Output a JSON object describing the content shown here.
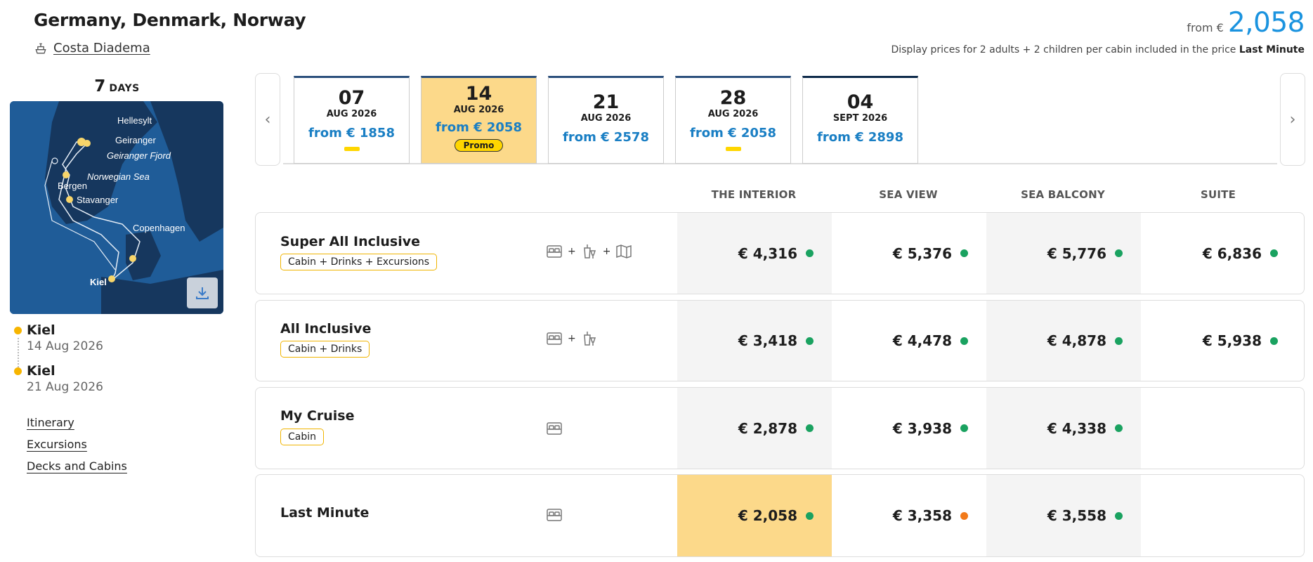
{
  "header": {
    "title": "Germany, Denmark, Norway",
    "ship_name": "Costa Diadema",
    "from_label": "from €",
    "from_value": "2,058",
    "price_note_prefix": "Display prices for 2 adults + 2 children per cabin included in the price",
    "price_note_bold": "Last Minute"
  },
  "sidebar": {
    "days_number": "7",
    "days_label": "DAYS",
    "map_labels": [
      "Hellesylt",
      "Geiranger",
      "Geiranger Fjord",
      "Norwegian Sea",
      "Bergen",
      "Stavanger",
      "Copenhagen",
      "Kiel"
    ],
    "stops": [
      {
        "name": "Kiel",
        "date": "14 Aug 2026"
      },
      {
        "name": "Kiel",
        "date": "21 Aug 2026"
      }
    ],
    "links": [
      "Itinerary",
      "Excursions",
      "Decks and Cabins"
    ]
  },
  "dates": [
    {
      "day": "07",
      "month": "AUG 2026",
      "price": "from € 1858",
      "badge": "flag"
    },
    {
      "day": "14",
      "month": "AUG 2026",
      "price": "from € 2058",
      "badge": "promo",
      "promo_label": "Promo",
      "selected": true
    },
    {
      "day": "21",
      "month": "AUG 2026",
      "price": "from € 2578",
      "badge": ""
    },
    {
      "day": "28",
      "month": "AUG 2026",
      "price": "from € 2058",
      "badge": "flag"
    },
    {
      "day": "04",
      "month": "SEPT 2026",
      "price": "from € 2898",
      "badge": ""
    }
  ],
  "columns": [
    "THE INTERIOR",
    "SEA VIEW",
    "SEA BALCONY",
    "SUITE"
  ],
  "fares": [
    {
      "name": "Super All Inclusive",
      "tag": "Cabin + Drinks + Excursions",
      "icons": [
        "bed-icon",
        "drinks-icon",
        "map-icon"
      ],
      "prices": [
        "€ 4,316",
        "€ 5,376",
        "€ 5,776",
        "€ 6,836"
      ]
    },
    {
      "name": "All Inclusive",
      "tag": "Cabin + Drinks",
      "icons": [
        "bed-icon",
        "drinks-icon"
      ],
      "prices": [
        "€ 3,418",
        "€ 4,478",
        "€ 4,878",
        "€ 5,938"
      ]
    },
    {
      "name": "My Cruise",
      "tag": "Cabin",
      "icons": [
        "bed-icon"
      ],
      "prices": [
        "€ 2,878",
        "€ 3,938",
        "€ 4,338",
        ""
      ]
    },
    {
      "name": "Last Minute",
      "tag": "",
      "icons": [
        "bed-icon"
      ],
      "prices": [
        "€ 2,058",
        "€ 3,358",
        "€ 3,558",
        ""
      ]
    }
  ],
  "colors": {
    "accent_blue": "#1a93df",
    "highlight_yellow": "#fcd98a",
    "available_green": "#1aa260",
    "limited_orange": "#f27a1a"
  }
}
